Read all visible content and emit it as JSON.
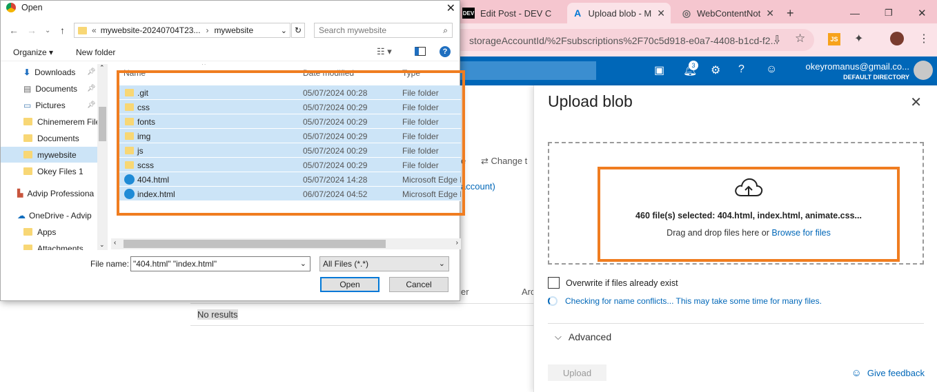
{
  "browser": {
    "tabs": [
      {
        "label": "Edit Post - DEV C",
        "favicon": "DEV"
      },
      {
        "label": "Upload blob - M",
        "favicon": "A"
      },
      {
        "label": "WebContentNot",
        "favicon": ""
      }
    ],
    "new_tab": "+",
    "address": "storageAccountId/%2Fsubscriptions%2F70c5d918-e0a7-4408-b1cd-f2..."
  },
  "azure": {
    "notification_count": "3",
    "account_email": "okeyromanus@gmail.co...",
    "account_directory": "DEFAULT DIRECTORY"
  },
  "background": {
    "change_tier": "Change t",
    "account_link": "account)",
    "col_er": "er",
    "col_arc": "Arc",
    "no_results": "No results",
    "frag_e": "e"
  },
  "upload_panel": {
    "title": "Upload blob",
    "files_selected": "460 file(s) selected: 404.html, index.html, animate.css...",
    "drag_text": "Drag and drop files here",
    "or_text": "or",
    "browse_link": "Browse for files",
    "overwrite_label": "Overwrite if files already exist",
    "checking_text": "Checking for name conflicts... This may take some time for many files.",
    "advanced_label": "Advanced",
    "upload_button": "Upload",
    "feedback_link": "Give feedback",
    "accent_color": "#0067b8",
    "highlight_color": "#f07d20"
  },
  "open_dialog": {
    "title": "Open",
    "path_prefix": "«",
    "path_folder": "mywebsite-20240704T23...",
    "path_current": "mywebsite",
    "search_placeholder": "Search mywebsite",
    "organize": "Organize",
    "new_folder": "New folder",
    "nav_items": [
      {
        "label": "Downloads",
        "icon": "download-icon",
        "pinned": true
      },
      {
        "label": "Documents",
        "icon": "documents-icon",
        "pinned": true
      },
      {
        "label": "Pictures",
        "icon": "pictures-icon",
        "pinned": true
      },
      {
        "label": "Chinemerem File",
        "icon": "folder-icon",
        "pinned": false
      },
      {
        "label": "Documents",
        "icon": "folder-icon",
        "pinned": false
      },
      {
        "label": "mywebsite",
        "icon": "folder-icon",
        "pinned": false
      },
      {
        "label": "Okey Files 1",
        "icon": "folder-icon",
        "pinned": false
      },
      {
        "label": "Advip Professiona",
        "icon": "app-icon",
        "pinned": false
      },
      {
        "label": "OneDrive - Advip",
        "icon": "cloud-icon",
        "pinned": false
      },
      {
        "label": "Apps",
        "icon": "folder-icon",
        "pinned": false
      },
      {
        "label": "Attachments",
        "icon": "folder-icon",
        "pinned": false
      }
    ],
    "columns": {
      "name": "Name",
      "date": "Date modified",
      "type": "Type"
    },
    "files": [
      {
        "name": ".git",
        "date": "05/07/2024 00:28",
        "type": "File folder",
        "kind": "folder"
      },
      {
        "name": "css",
        "date": "05/07/2024 00:29",
        "type": "File folder",
        "kind": "folder"
      },
      {
        "name": "fonts",
        "date": "05/07/2024 00:29",
        "type": "File folder",
        "kind": "folder"
      },
      {
        "name": "img",
        "date": "05/07/2024 00:29",
        "type": "File folder",
        "kind": "folder"
      },
      {
        "name": "js",
        "date": "05/07/2024 00:29",
        "type": "File folder",
        "kind": "folder"
      },
      {
        "name": "scss",
        "date": "05/07/2024 00:29",
        "type": "File folder",
        "kind": "folder"
      },
      {
        "name": "404.html",
        "date": "05/07/2024 14:28",
        "type": "Microsoft Edge H",
        "kind": "edge"
      },
      {
        "name": "index.html",
        "date": "06/07/2024 04:52",
        "type": "Microsoft Edge H",
        "kind": "edge"
      }
    ],
    "filename_label": "File name:",
    "filename_value": "\"404.html\" \"index.html\"",
    "filetype_value": "All Files (*.*)",
    "open_button": "Open",
    "cancel_button": "Cancel"
  }
}
